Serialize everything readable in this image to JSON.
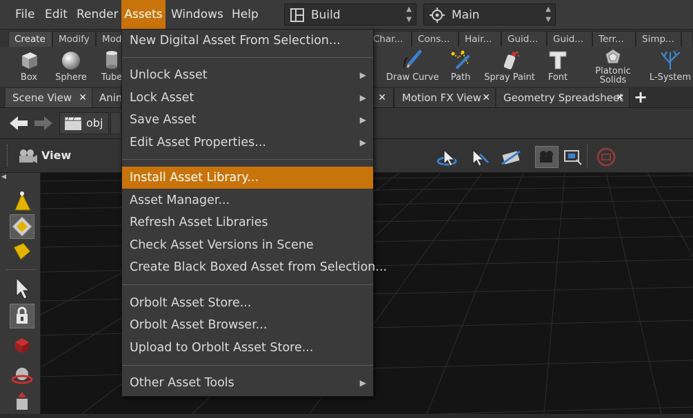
{
  "menubar": {
    "items": [
      "File",
      "Edit",
      "Render",
      "Assets",
      "Windows",
      "Help"
    ],
    "desktop_combo": "Build",
    "context_combo": "Main"
  },
  "shelf_tabs": [
    "Create",
    "Modify",
    "Mode",
    "Char...",
    "Cons...",
    "Hair...",
    "Guid...",
    "Guid...",
    "Terr...",
    "Simp..."
  ],
  "shelf_tools": {
    "box": "Box",
    "sphere": "Sphere",
    "tube": "Tube",
    "draw_curve": "Draw Curve",
    "path": "Path",
    "spray_paint": "Spray Paint",
    "font": "Font",
    "platonic_line1": "Platonic",
    "platonic_line2": "Solids",
    "lsystem": "L-System"
  },
  "pane_tabs": {
    "scene_view": "Scene View",
    "anim": "Anim",
    "motion_fx": "Motion FX View",
    "spreadsheet": "Geometry Spreadsheet"
  },
  "path_bar": {
    "node": "obj"
  },
  "view_bar": {
    "label": "View"
  },
  "assets_menu": {
    "new_digital_asset": "New Digital Asset From Selection...",
    "unlock": "Unlock Asset",
    "lock": "Lock Asset",
    "save": "Save Asset",
    "edit_props": "Edit Asset Properties...",
    "install_library": "Install Asset Library...",
    "asset_manager": "Asset Manager...",
    "refresh": "Refresh Asset Libraries",
    "check_versions": "Check Asset Versions in Scene",
    "black_boxed": "Create Black Boxed Asset from Selection...",
    "orbolt_store": "Orbolt Asset Store...",
    "orbolt_browser": "Orbolt Asset Browser...",
    "upload_orbolt": "Upload to Orbolt Asset Store...",
    "other_tools": "Other Asset Tools"
  },
  "colors": {
    "highlight": "#c8740a",
    "menu_bg": "#3a3a3a",
    "viewport_bg": "#141414"
  }
}
